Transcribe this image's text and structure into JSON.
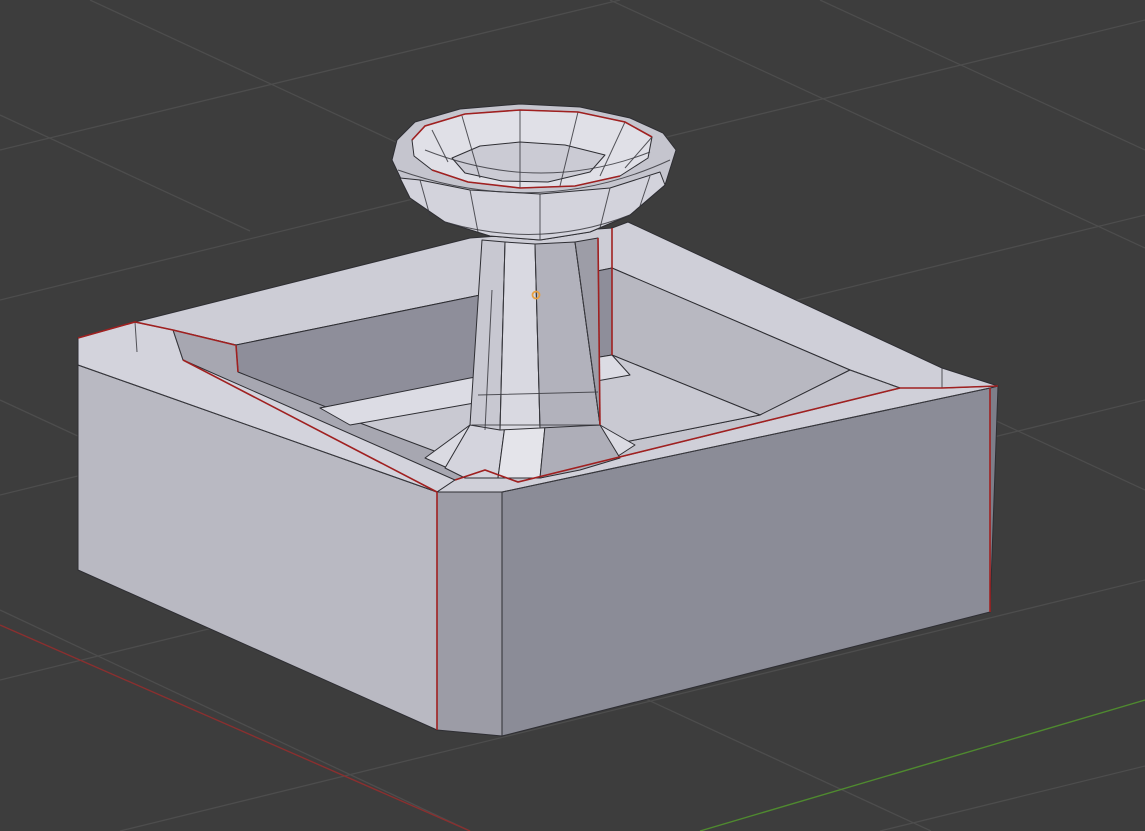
{
  "viewport": {
    "background": "#3d3d3d",
    "grid_color": "#4d4d4d",
    "x_axis_color": "#8a2f2f",
    "y_axis_color": "#4f8a2f",
    "seam_color": "#a02020",
    "origin_color": "#e8a040"
  },
  "object": {
    "type": "mesh",
    "shape": "fountain",
    "face_colors": {
      "light": "#d6d6df",
      "mid": "#b4b4bd",
      "shade": "#9a9aa4",
      "dark": "#8a8b96"
    }
  }
}
